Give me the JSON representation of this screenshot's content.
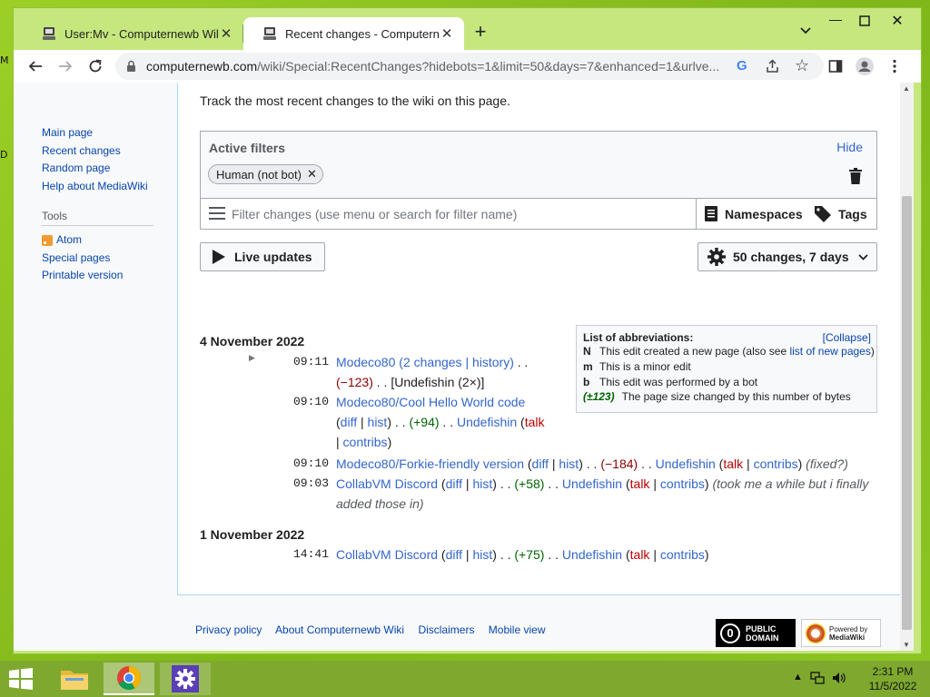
{
  "desktop": {
    "fragment_1": "M",
    "fragment_2": "D"
  },
  "window": {
    "tabs": [
      {
        "title": "User:Mv - Computernewb Wiki",
        "active": false
      },
      {
        "title": "Recent changes - Computernewb",
        "active": true
      }
    ],
    "new_tab": "+",
    "minimize": "—",
    "close": "✕",
    "url_host": "computernewb.com",
    "url_path": "/wiki/Special:RecentChanges?hidebots=1&limit=50&days=7&enhanced=1&urlve...",
    "google_badge": "G"
  },
  "sidebar": {
    "nav": [
      "Main page",
      "Recent changes",
      "Random page",
      "Help about MediaWiki"
    ],
    "tools_heading": "Tools",
    "tools": [
      "Atom",
      "Special pages",
      "Printable version"
    ]
  },
  "page": {
    "intro": "Track the most recent changes to the wiki on this page.",
    "filters": {
      "heading": "Active filters",
      "hide": "Hide",
      "chip": "Human (not bot)",
      "placeholder": "Filter changes (use menu or search for filter name)",
      "namespaces": "Namespaces",
      "tags": "Tags"
    },
    "live_updates": "Live updates",
    "period": "50 changes, 7 days",
    "legend": {
      "title": "List of abbreviations:",
      "collapse": "[Collapse]",
      "rows": [
        {
          "key": "N",
          "text": "This edit created a new page (also see ",
          "link": "list of new pages",
          "after": ")"
        },
        {
          "key": "m",
          "text": "This is a minor edit"
        },
        {
          "key": "b",
          "text": "This edit was performed by a bot"
        },
        {
          "key": "(±123)",
          "text": "The page size changed by this number of bytes"
        }
      ]
    },
    "days": [
      {
        "heading": "4 November 2022",
        "changes": [
          {
            "time": "09:11",
            "page": "Modeco80",
            "changes": "2 changes",
            "history": "history",
            "size": "(−123)",
            "users": "[Undefishin (2×)]"
          },
          {
            "time": "09:10",
            "page": "Modeco80/Cool Hello World code",
            "diff": "diff",
            "hist": "hist",
            "size": "(+94)",
            "user": "Undefishin",
            "talk": "talk",
            "contribs": "contribs"
          },
          {
            "time": "09:10",
            "page": "Modeco80/Forkie-friendly version",
            "diff": "diff",
            "hist": "hist",
            "size": "(−184)",
            "user": "Undefishin",
            "talk": "talk",
            "contribs": "contribs",
            "summary": "(fixed?)"
          },
          {
            "time": "09:03",
            "page": "CollabVM Discord",
            "diff": "diff",
            "hist": "hist",
            "size": "(+58)",
            "user": "Undefishin",
            "talk": "talk",
            "contribs": "contribs",
            "summary_1": "(took me a while but i finally",
            "summary_2": "added those in)"
          }
        ]
      },
      {
        "heading": "1 November 2022",
        "changes": [
          {
            "time": "14:41",
            "page": "CollabVM Discord",
            "diff": "diff",
            "hist": "hist",
            "size": "(+75)",
            "user": "Undefishin",
            "talk": "talk",
            "contribs": "contribs"
          }
        ]
      }
    ],
    "footer": [
      "Privacy policy",
      "About Computernewb Wiki",
      "Disclaimers",
      "Mobile view"
    ],
    "pd_badge": [
      "PUBLIC",
      "DOMAIN"
    ],
    "pd_symbol": "0",
    "mw_badge": [
      "Powered by",
      "MediaWiki"
    ]
  },
  "taskbar": {
    "time": "2:31 PM",
    "date": "11/5/2022"
  },
  "colors": {
    "link": "#3366cc",
    "negative": "#8b0000",
    "positive": "#006400",
    "desktop": "#8cc21c"
  }
}
